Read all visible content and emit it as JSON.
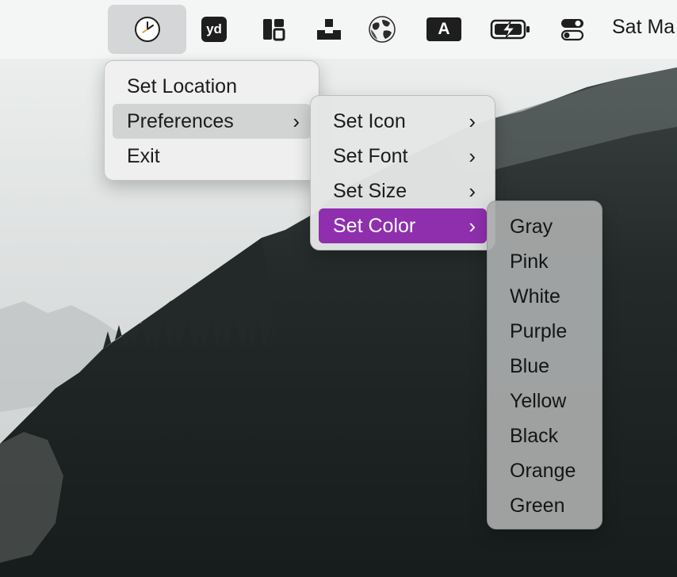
{
  "menubar": {
    "items": [
      {
        "icon": "clock-icon"
      },
      {
        "icon": "yd-icon",
        "text": "yd"
      },
      {
        "icon": "layout-icon"
      },
      {
        "icon": "steps-icon"
      },
      {
        "icon": "globe-icon"
      },
      {
        "icon": "font-icon",
        "text": "A"
      },
      {
        "icon": "battery-charging-icon"
      },
      {
        "icon": "control-toggle-icon"
      }
    ],
    "date": "Sat Ma"
  },
  "main_menu": {
    "items": [
      {
        "label": "Set Location"
      },
      {
        "label": "Preferences",
        "submenu": true
      },
      {
        "label": "Exit"
      }
    ]
  },
  "preferences_menu": {
    "items": [
      {
        "label": "Set Icon",
        "submenu": true
      },
      {
        "label": "Set Font",
        "submenu": true
      },
      {
        "label": "Set Size",
        "submenu": true
      },
      {
        "label": "Set Color",
        "submenu": true
      }
    ]
  },
  "color_menu": {
    "items": [
      {
        "label": "Gray"
      },
      {
        "label": "Pink"
      },
      {
        "label": "White"
      },
      {
        "label": "Purple"
      },
      {
        "label": "Blue"
      },
      {
        "label": "Yellow"
      },
      {
        "label": "Black"
      },
      {
        "label": "Orange"
      },
      {
        "label": "Green"
      }
    ]
  },
  "colors": {
    "highlight": "#8f2fae",
    "menubar_bg": "#f4f5f5",
    "forest": "#1f2625"
  }
}
